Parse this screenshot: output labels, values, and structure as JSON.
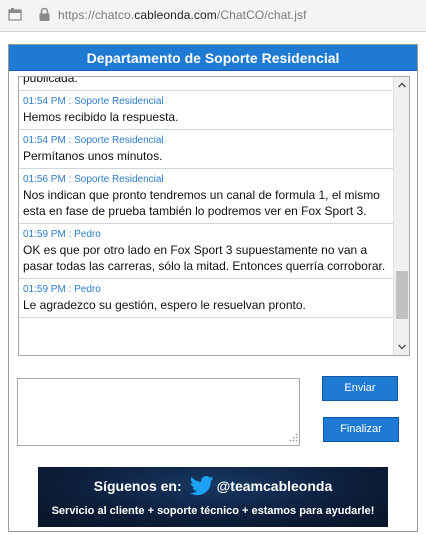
{
  "browser": {
    "url_prefix": "https://chatco.",
    "url_domain": "cableonda.com",
    "url_path": "/ChatCO/chat.jsf"
  },
  "chat": {
    "header_title": "Departamento de Soporte Residencial",
    "messages": [
      {
        "meta": "",
        "text": "publicada."
      },
      {
        "meta": "01:54 PM : Soporte Residencial",
        "text": "Hemos recibido la respuesta."
      },
      {
        "meta": "01:54 PM : Soporte Residencial",
        "text": "Permítanos unos minutos."
      },
      {
        "meta": "01:56 PM : Soporte Residencial",
        "text": "Nos indican que pronto tendremos un canal de formula 1, el mismo esta en fase de prueba también lo podremos ver en Fox Sport 3."
      },
      {
        "meta": "01:59 PM : Pedro",
        "text": "OK es que por otro lado en Fox Sport 3 supuestamente no van a pasar todas las carreras, sólo la mitad. Entonces querría corroborar."
      },
      {
        "meta": "01:59 PM : Pedro",
        "text": "Le agradezco su gestión, espero le resuelvan pronto."
      }
    ]
  },
  "reply": {
    "value": "",
    "send_label": "Enviar",
    "end_label": "Finalizar"
  },
  "banner": {
    "follow_text": "Síguenos en:",
    "handle": "@teamcableonda",
    "tagline": "Servicio al cliente + soporte técnico + estamos para ayudarle!"
  },
  "colors": {
    "header_blue": "#1f7ad4",
    "meta_blue": "#2d7ccb",
    "twitter_blue": "#1da1f2",
    "banner_navy": "#0a1730"
  },
  "icons": {
    "page": "page-icon",
    "lock": "lock-icon",
    "twitter": "twitter-bird-icon",
    "scroll_up": "chevron-up-icon",
    "scroll_down": "chevron-down-icon",
    "resize": "resize-grip-icon"
  }
}
